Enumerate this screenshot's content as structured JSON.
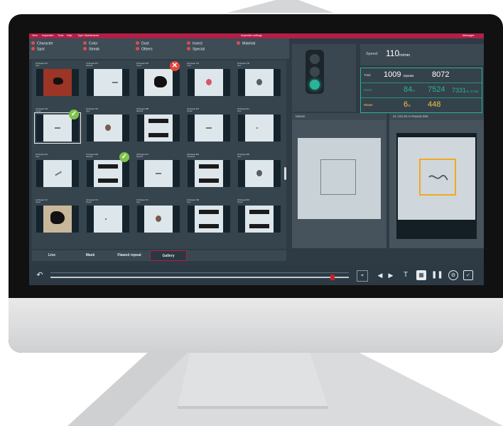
{
  "menu": {
    "items": [
      "View",
      "Inspection",
      "Tools",
      "Help",
      "Type: Maintenance"
    ],
    "center": "Inspection settings",
    "right": "Messages"
  },
  "categories": [
    {
      "label": "Character",
      "color": "#e04b52"
    },
    {
      "label": "Spot",
      "color": "#e04b52"
    },
    {
      "label": "Color",
      "color": "#e04b52"
    },
    {
      "label": "Streak",
      "color": "#e04b52"
    },
    {
      "label": "Dust",
      "color": "#e04b52"
    },
    {
      "label": "Others",
      "color": "#e04b52"
    },
    {
      "label": "Insect",
      "color": "#e04b52"
    },
    {
      "label": "Special",
      "color": "#e04b52"
    },
    {
      "label": "Material",
      "color": "#e04b52"
    }
  ],
  "gallery": {
    "cells": [
      {
        "caption": "26   Repeat 497",
        "sub": "Spot",
        "thumb": "red-square"
      },
      {
        "caption": "27   Repeat 507",
        "sub": "Material",
        "thumb": "streak-right"
      },
      {
        "caption": "28   Repeat 522",
        "sub": "Insect",
        "thumb": "insect",
        "badge": "reject"
      },
      {
        "caption": "29   Repeat 720",
        "sub": "Color",
        "thumb": "pink-spot"
      },
      {
        "caption": "30   Repeat 746",
        "sub": "Spot",
        "thumb": "gray-blob"
      },
      {
        "caption": "31   Repeat 793",
        "sub": "Streak",
        "thumb": "streak",
        "selected": true,
        "badge": "accept"
      },
      {
        "caption": "32   Repeat 794",
        "sub": "Spot",
        "thumb": "brown-drop"
      },
      {
        "caption": "33   Repeat 988",
        "sub": "Material",
        "thumb": "letters"
      },
      {
        "caption": "34   Repeat 997",
        "sub": "Streak",
        "thumb": "faint-streak"
      },
      {
        "caption": "35   Repeat 911",
        "sub": "Dust",
        "thumb": "dot"
      },
      {
        "caption": "36   Repeat 924",
        "sub": "Spot",
        "thumb": "check-mark"
      },
      {
        "caption": "37   Repeat 938",
        "sub": "Material",
        "thumb": "text-pdnb",
        "badge": "accept"
      },
      {
        "caption": "38   Repeat 972",
        "sub": "Material",
        "thumb": "small-dash"
      },
      {
        "caption": "39   Repeat 984",
        "sub": "Character",
        "thumb": "text-e"
      },
      {
        "caption": "40   Repeat 989",
        "sub": "Spot",
        "thumb": "gray-blob"
      },
      {
        "caption": "41   Repeat 711",
        "sub": "Insect",
        "thumb": "black-flake"
      },
      {
        "caption": "42   Repeat 715",
        "sub": "Streak",
        "thumb": "faint-dot"
      },
      {
        "caption": "43   Repeat 721",
        "sub": "Spot",
        "thumb": "brown-dot"
      },
      {
        "caption": "44   Repeat 798",
        "sub": "Spot",
        "thumb": "text-ade"
      },
      {
        "caption": "45   Repeat 818",
        "sub": "Streak",
        "thumb": "lines"
      }
    ],
    "tabs": [
      "Live",
      "Mask",
      "Flawed repeat",
      "Gallery"
    ],
    "active_tab": "Gallery"
  },
  "traffic_light": {
    "active": "green"
  },
  "speed": {
    "label": "Speed:",
    "value": "110",
    "unit": "m/min"
  },
  "stats": {
    "total": {
      "label": "Total",
      "value": "1009",
      "unit": "repeats",
      "extra": "8072"
    },
    "good": {
      "label": "Good",
      "value": "84",
      "unit": "%",
      "extra": "7524",
      "extra2": "7331",
      "extra2_unit": "% of 164"
    },
    "waste": {
      "label": "Waste",
      "value": "6",
      "unit": "%",
      "extra": "448"
    }
  },
  "master": {
    "title": "Master"
  },
  "flaw": {
    "title": "31   103.28 m   Repeat 556"
  },
  "colors": {
    "brand": "#b11f46",
    "teal": "#2bb39b",
    "yellow": "#f4c542",
    "accept": "#7ec34b",
    "reject": "#e5483b",
    "orange": "#f3a81f"
  }
}
